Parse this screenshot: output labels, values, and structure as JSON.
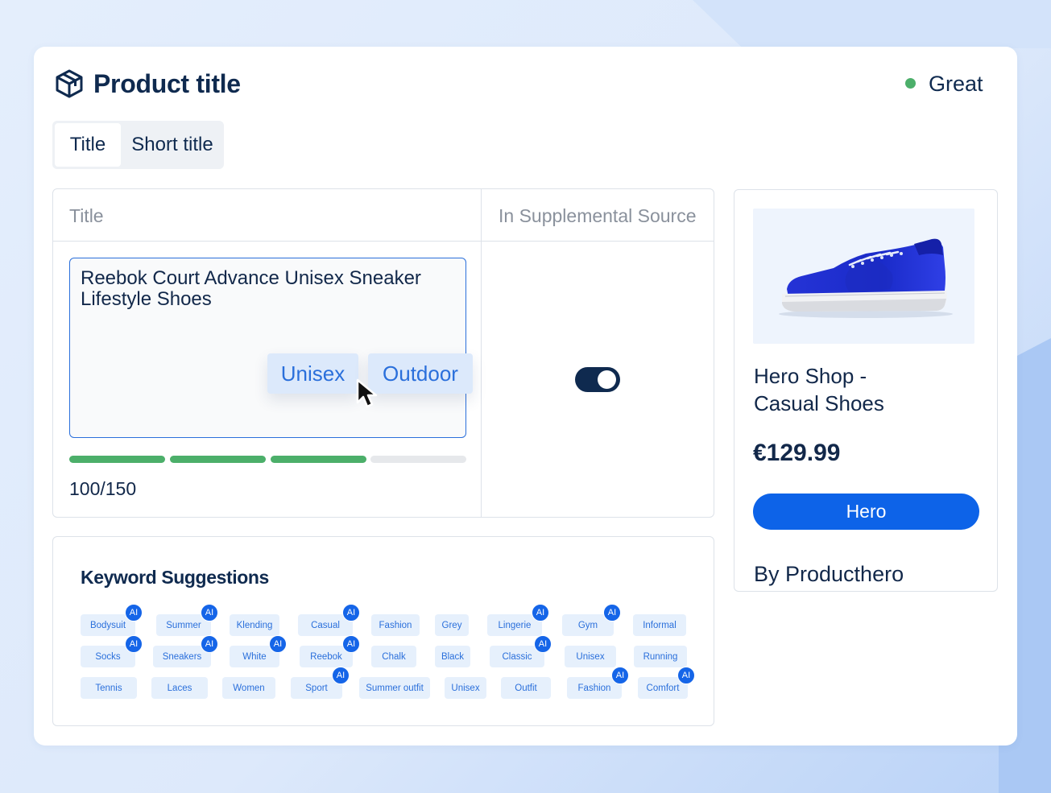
{
  "header": {
    "title": "Product title",
    "icon": "box-icon",
    "status": {
      "label": "Great",
      "color": "#4caf6a"
    }
  },
  "tabs": [
    {
      "label": "Title",
      "active": true
    },
    {
      "label": "Short title",
      "active": false
    }
  ],
  "table": {
    "headers": [
      "Title",
      "In Supplemental Source"
    ],
    "title_value": "Reebok Court Advance Unisex Sneaker Lifestyle Shoes",
    "suggested_chips": [
      "Unisex",
      "Outdoor"
    ],
    "progress": {
      "filled_segments": 3,
      "total_segments": 4,
      "fraction": 0.667
    },
    "counter": "100/150",
    "supplemental_source_enabled": true
  },
  "keywords": {
    "title": "Keyword Suggestions",
    "rows": [
      [
        {
          "label": "Bodysuit",
          "ai": true
        },
        {
          "label": "Summer",
          "ai": true
        },
        {
          "label": "Klending",
          "ai": false
        },
        {
          "label": "Casual",
          "ai": true
        },
        {
          "label": "Fashion",
          "ai": false
        },
        {
          "label": "Grey",
          "ai": false
        },
        {
          "label": "Lingerie",
          "ai": true
        },
        {
          "label": "Gym",
          "ai": true
        },
        {
          "label": "Informal",
          "ai": false
        }
      ],
      [
        {
          "label": "Socks",
          "ai": true
        },
        {
          "label": "Sneakers",
          "ai": true
        },
        {
          "label": "White",
          "ai": true
        },
        {
          "label": "Reebok",
          "ai": true
        },
        {
          "label": "Chalk",
          "ai": false
        },
        {
          "label": "Black",
          "ai": false
        },
        {
          "label": "Classic",
          "ai": true
        },
        {
          "label": "Unisex",
          "ai": false
        },
        {
          "label": "Running",
          "ai": false
        }
      ],
      [
        {
          "label": "Tennis",
          "ai": false
        },
        {
          "label": "Laces",
          "ai": false
        },
        {
          "label": "Women",
          "ai": false
        },
        {
          "label": "Sport",
          "ai": true
        },
        {
          "label": "Summer outfit",
          "ai": false
        },
        {
          "label": "Unisex",
          "ai": false
        },
        {
          "label": "Outfit",
          "ai": false
        },
        {
          "label": "Fashion",
          "ai": true
        },
        {
          "label": "Comfort",
          "ai": true
        }
      ]
    ],
    "ai_badge_label": "AI"
  },
  "preview": {
    "image": "blue-sneaker",
    "name_line1": "Hero Shop -",
    "name_line2": "Casual Shoes",
    "price": "€129.99",
    "button_label": "Hero",
    "by_line": "By Producthero"
  },
  "colors": {
    "accent": "#0d63e8",
    "navy": "#0f2a4f",
    "success": "#4caf6a"
  }
}
